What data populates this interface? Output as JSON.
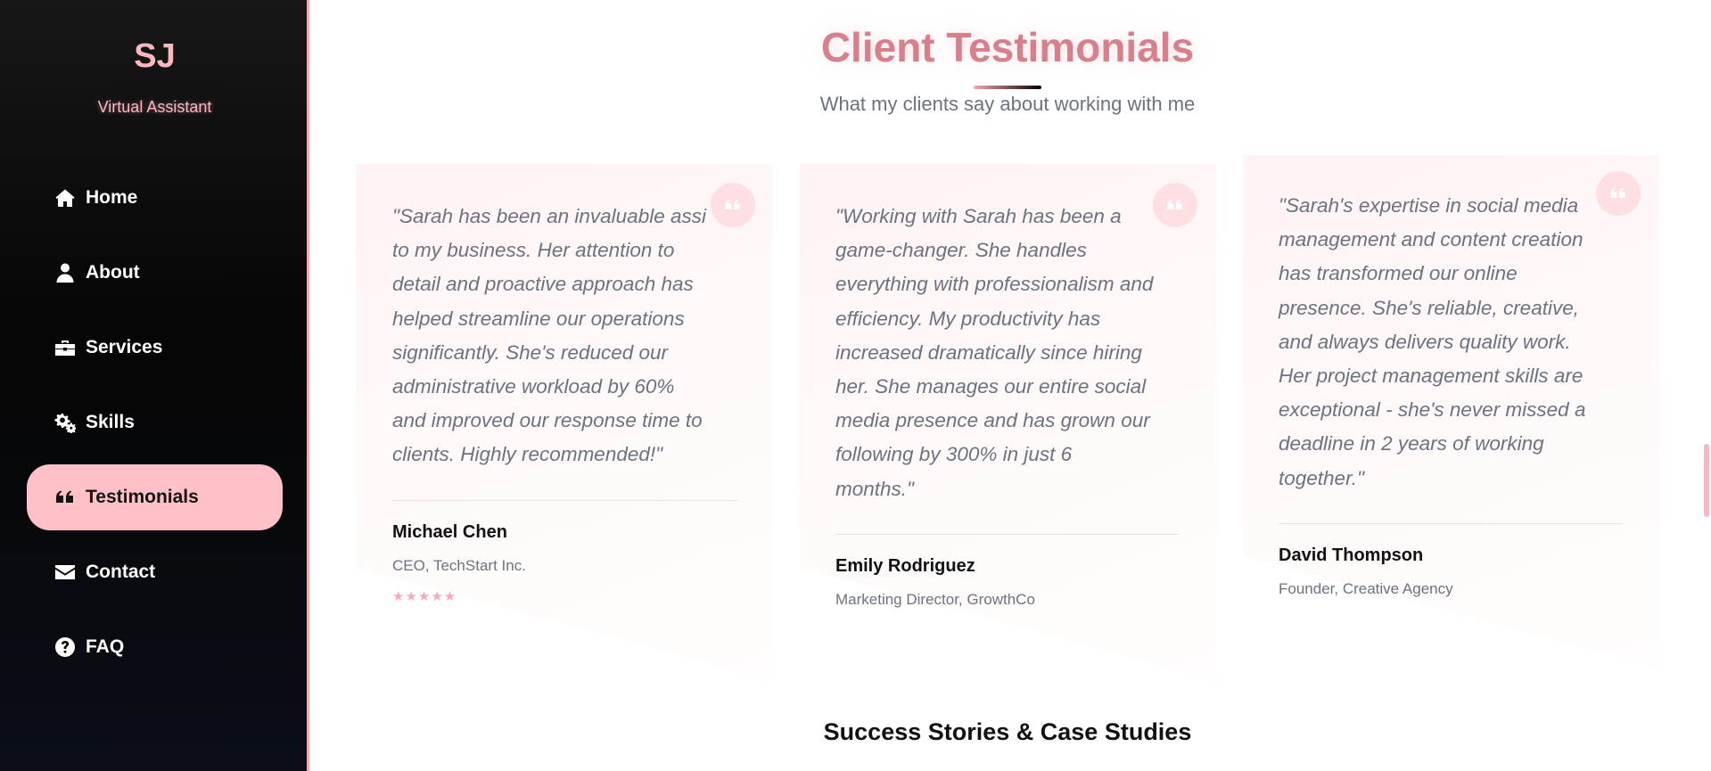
{
  "sidebar": {
    "logo": "SJ",
    "role": "Virtual Assistant",
    "items": [
      {
        "label": "Home",
        "icon": "home-icon",
        "active": false
      },
      {
        "label": "About",
        "icon": "user-icon",
        "active": false
      },
      {
        "label": "Services",
        "icon": "briefcase-icon",
        "active": false
      },
      {
        "label": "Skills",
        "icon": "gears-icon",
        "active": false
      },
      {
        "label": "Testimonials",
        "icon": "quote-icon",
        "active": true
      },
      {
        "label": "Contact",
        "icon": "envelope-icon",
        "active": false
      },
      {
        "label": "FAQ",
        "icon": "question-circle-icon",
        "active": false
      }
    ]
  },
  "main": {
    "title": "Client Testimonials",
    "subtitle": "What my clients say about working with me",
    "testimonials": [
      {
        "quote_lines": [
          "\"Sarah has been an invaluable assi",
          "to my business. Her attention to",
          "detail and proactive approach has",
          "helped streamline our operations",
          "significantly. She's reduced our",
          "administrative workload by 60%",
          "and improved our response time to",
          "clients. Highly recommended!\""
        ],
        "name": "Michael Chen",
        "role": "CEO, TechStart Inc.",
        "stars": "★★★★★"
      },
      {
        "quote_lines": [
          "\"Working with Sarah has been a",
          "game-changer. She handles",
          "everything with professionalism and",
          "efficiency. My productivity has",
          "increased dramatically since hiring",
          "her. She manages our entire social",
          "media presence and has grown our",
          "following by 300% in just 6",
          "months.\""
        ],
        "name": "Emily Rodriguez",
        "role": "Marketing Director, GrowthCo"
      },
      {
        "quote_lines": [
          "\"Sarah's expertise in social media",
          "management and content creation",
          "has transformed our online",
          "presence. She's reliable, creative,",
          "and always delivers quality work.",
          "Her project management skills are",
          "exceptional - she's never missed a",
          "deadline in 2 years of working",
          "together.\""
        ],
        "name": "David Thompson",
        "role": "Founder, Creative Agency"
      }
    ],
    "section_heading": "Success Stories & Case Studies"
  },
  "colors": {
    "accent": "#ffc0c7",
    "title": "#d7808c",
    "sidebar_bg": "#0b0b0b",
    "text_muted": "#6b7280"
  }
}
